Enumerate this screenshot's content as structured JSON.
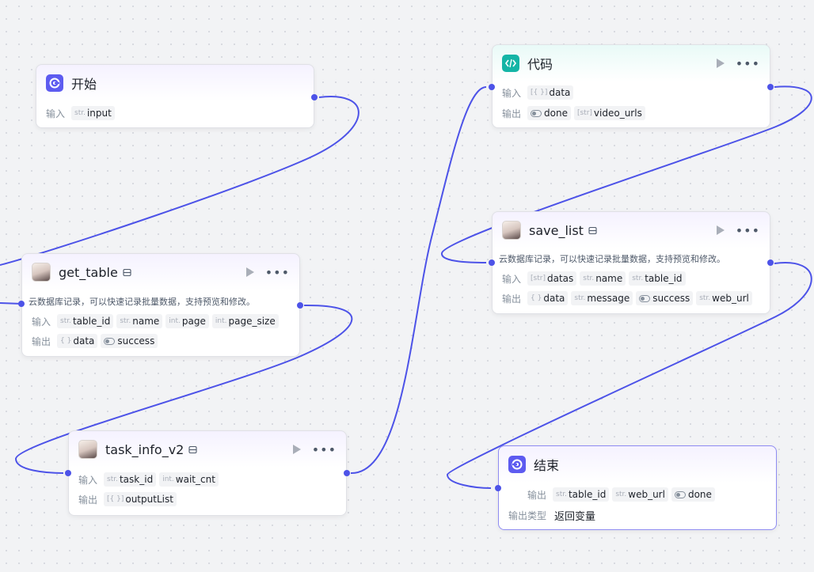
{
  "nodes": {
    "start": {
      "title": "开始",
      "input_label": "输入",
      "inputs": [
        {
          "type": "str.",
          "name": "input"
        }
      ]
    },
    "get_table": {
      "title": "get_table",
      "desc": "云数据库记录，可以快速记录批量数据，支持预览和修改。",
      "input_label": "输入",
      "output_label": "输出",
      "inputs": [
        {
          "type": "str.",
          "name": "table_id"
        },
        {
          "type": "str.",
          "name": "name"
        },
        {
          "type": "int.",
          "name": "page"
        },
        {
          "type": "int.",
          "name": "page_size"
        }
      ],
      "outputs": [
        {
          "type": "{ }",
          "name": "data"
        },
        {
          "type": "toggle",
          "name": "success"
        }
      ]
    },
    "task_info": {
      "title": "task_info_v2",
      "input_label": "输入",
      "output_label": "输出",
      "inputs": [
        {
          "type": "str.",
          "name": "task_id"
        },
        {
          "type": "int.",
          "name": "wait_cnt"
        }
      ],
      "outputs": [
        {
          "type": "[{ }]",
          "name": "outputList"
        }
      ]
    },
    "code": {
      "title": "代码",
      "input_label": "输入",
      "output_label": "输出",
      "inputs": [
        {
          "type": "[{ }]",
          "name": "data"
        }
      ],
      "outputs": [
        {
          "type": "toggle",
          "name": "done"
        },
        {
          "type": "[str]",
          "name": "video_urls"
        }
      ]
    },
    "save_list": {
      "title": "save_list",
      "desc": "云数据库记录，可以快速记录批量数据，支持预览和修改。",
      "input_label": "输入",
      "output_label": "输出",
      "inputs": [
        {
          "type": "[str]",
          "name": "datas"
        },
        {
          "type": "str.",
          "name": "name"
        },
        {
          "type": "str.",
          "name": "table_id"
        }
      ],
      "outputs": [
        {
          "type": "{ }",
          "name": "data"
        },
        {
          "type": "str.",
          "name": "message"
        },
        {
          "type": "toggle",
          "name": "success"
        },
        {
          "type": "str.",
          "name": "web_url"
        }
      ]
    },
    "end": {
      "title": "结束",
      "output_label": "输出",
      "outputs": [
        {
          "type": "str.",
          "name": "table_id"
        },
        {
          "type": "str.",
          "name": "web_url"
        },
        {
          "type": "toggle",
          "name": "done"
        }
      ],
      "output_type_label": "输出类型",
      "output_type_value": "返回变量"
    }
  },
  "colors": {
    "edge": "#4d53e8",
    "start_icon": "#5d5bf0",
    "code_icon": "#14b5a6"
  },
  "icons": {
    "start": "start-icon",
    "code": "code-icon",
    "plugin": "avatar-icon",
    "database": "database-icon",
    "run": "play-icon",
    "menu": "more-icon",
    "end": "end-icon"
  }
}
